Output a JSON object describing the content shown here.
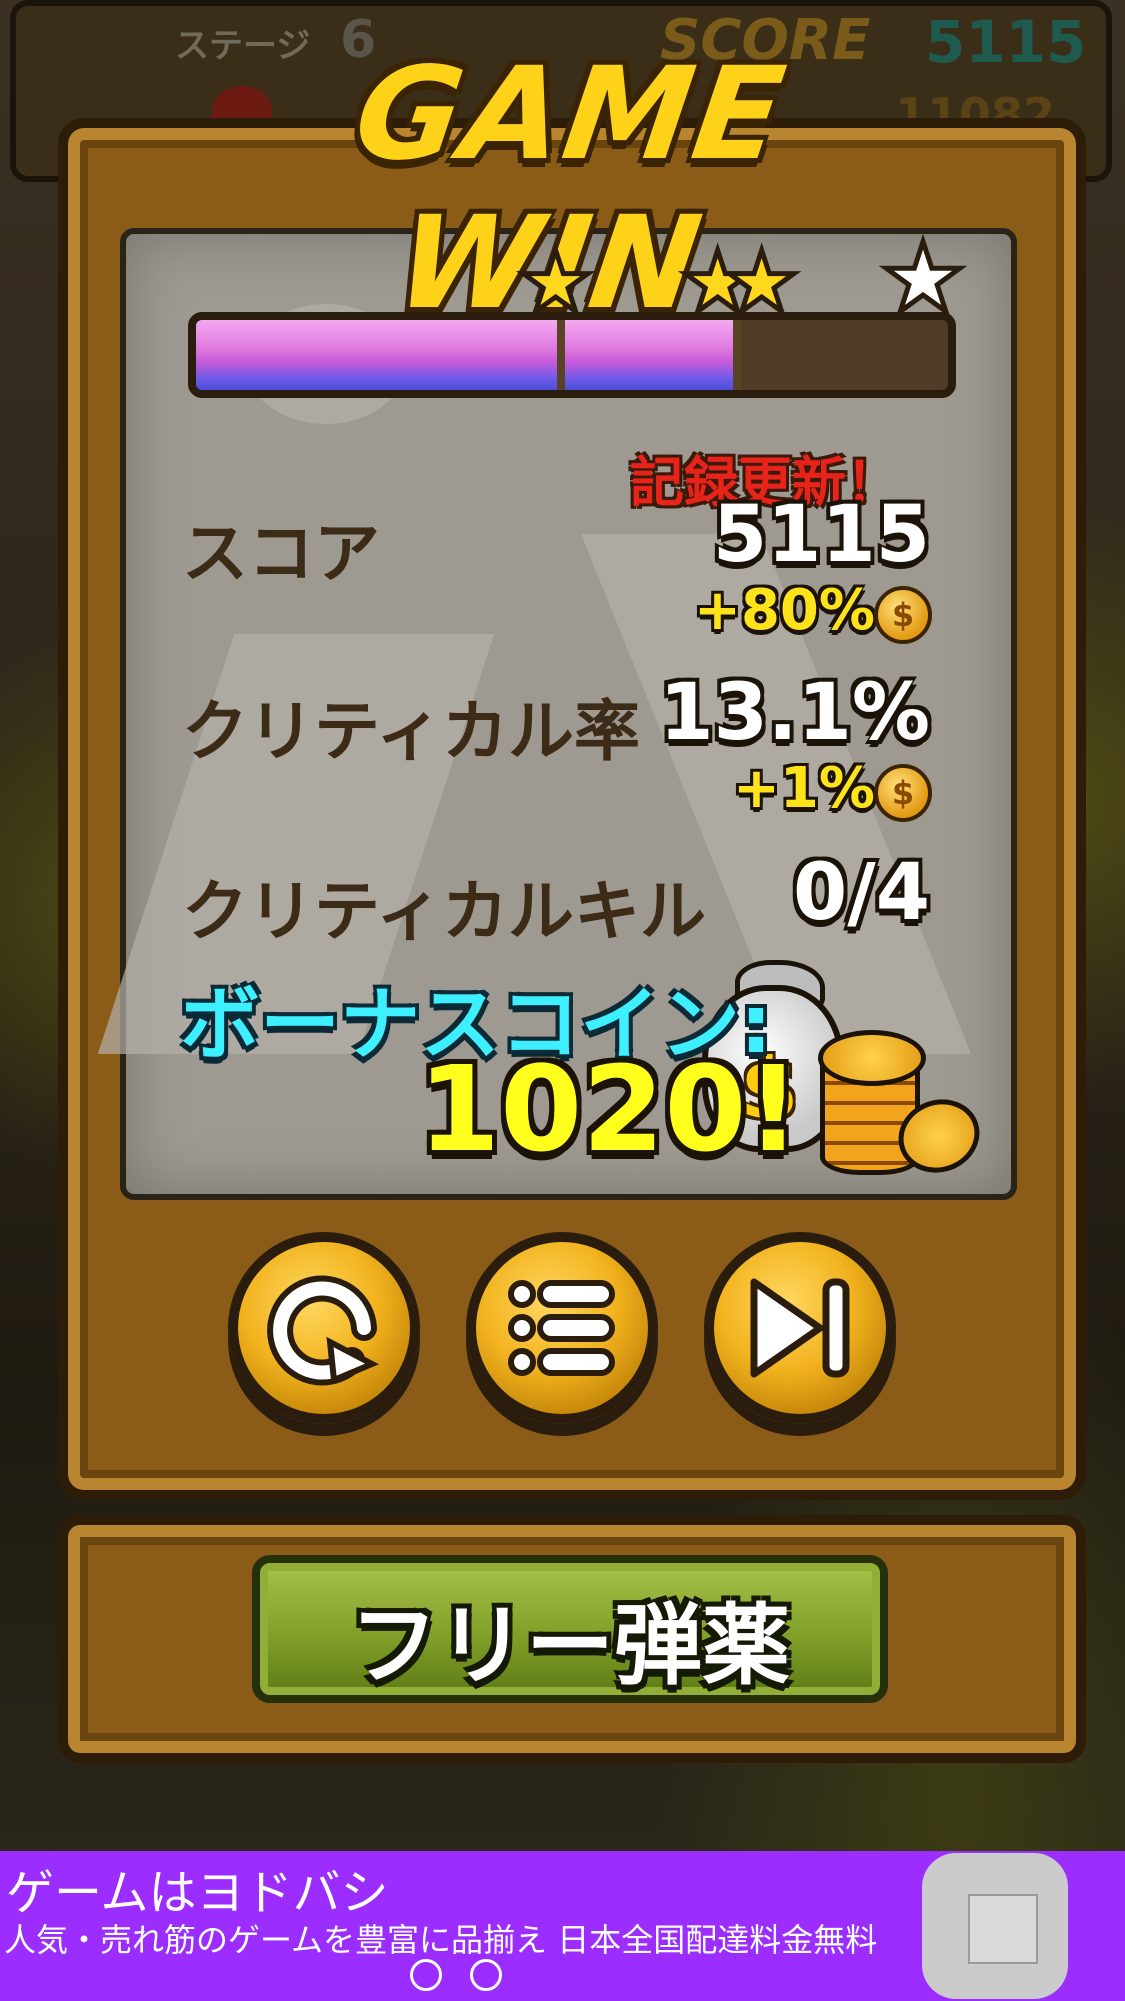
{
  "hud": {
    "stage_label": "ステージ",
    "stage_number": "6",
    "score_label": "SCORE",
    "score_value": "5115",
    "high_score_partial": "11082"
  },
  "title": "GAME WIN",
  "progress": {
    "fill_fraction": 0.73,
    "thresholds": [
      0.49,
      0.73
    ],
    "stars": [
      "gold",
      "gold-double",
      "white"
    ]
  },
  "record_label": "記録更新！",
  "stats": [
    {
      "label": "スコア",
      "value": "5115",
      "bonus": "+80%"
    },
    {
      "label": "クリティカル率",
      "value": "13.1%",
      "bonus": "+1%"
    },
    {
      "label": "クリティカルキル",
      "value": "0/4"
    }
  ],
  "bonus_coin": {
    "label": "ボーナスコイン:",
    "value": "1020!"
  },
  "buttons": {
    "retry_icon": "retry-icon",
    "menu_icon": "menu-list-icon",
    "next_icon": "next-stage-icon"
  },
  "free_ammo_label": "フリー弾薬",
  "ad": {
    "title": "ゲームはヨドバシ",
    "text": "人気・売れ筋のゲームを豊富に品揃え 日本全国配達料金無料",
    "bg_color": "#9b2dff"
  },
  "colors": {
    "accent_gold": "#ffd21a",
    "bonus_cyan": "#3ef0ff",
    "record_red": "#e8231a",
    "coin_yellow": "#ffe31a"
  }
}
